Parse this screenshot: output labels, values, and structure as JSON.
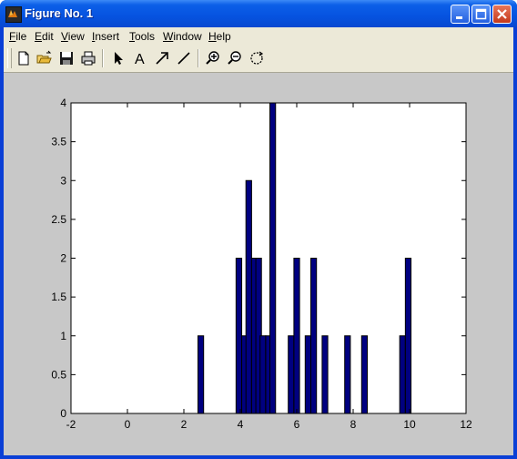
{
  "window": {
    "title": "Figure No. 1"
  },
  "menu": [
    {
      "label": "File",
      "key": "F",
      "rest": "ile"
    },
    {
      "label": "Edit",
      "key": "E",
      "rest": "dit"
    },
    {
      "label": "View",
      "key": "V",
      "rest": "iew"
    },
    {
      "label": "Insert",
      "key": "I",
      "rest": "nsert"
    },
    {
      "label": "Tools",
      "key": "T",
      "rest": "ools"
    },
    {
      "label": "Window",
      "key": "W",
      "rest": "indow"
    },
    {
      "label": "Help",
      "key": "H",
      "rest": "elp"
    }
  ],
  "toolbar": {
    "buttons": [
      "new-file-icon",
      "open-folder-icon",
      "save-icon",
      "print-icon",
      "select-arrow-icon",
      "insert-text-icon",
      "insert-arrow-icon",
      "insert-line-icon",
      "zoom-in-icon",
      "zoom-out-icon",
      "rotate-icon"
    ]
  },
  "chart_data": {
    "type": "bar",
    "title": "",
    "xlabel": "",
    "ylabel": "",
    "xlim": [
      -2,
      12
    ],
    "ylim": [
      0,
      4
    ],
    "xticks": [
      "-2",
      "0",
      "2",
      "4",
      "6",
      "8",
      "10",
      "12"
    ],
    "yticks": [
      "0",
      "0.5",
      "1",
      "1.5",
      "2",
      "2.5",
      "3",
      "3.5",
      "4"
    ],
    "bar_width": 0.2,
    "bar_color": "#000080",
    "x": [
      2.6,
      3.95,
      4.15,
      4.3,
      4.5,
      4.65,
      4.8,
      5.0,
      5.15,
      5.8,
      6.0,
      6.4,
      6.6,
      7.0,
      7.8,
      8.4,
      9.75,
      9.95
    ],
    "values": [
      1,
      2,
      1,
      3,
      2,
      2,
      1,
      1,
      4,
      1,
      2,
      1,
      2,
      1,
      1,
      1,
      1,
      2
    ],
    "grid": false
  }
}
